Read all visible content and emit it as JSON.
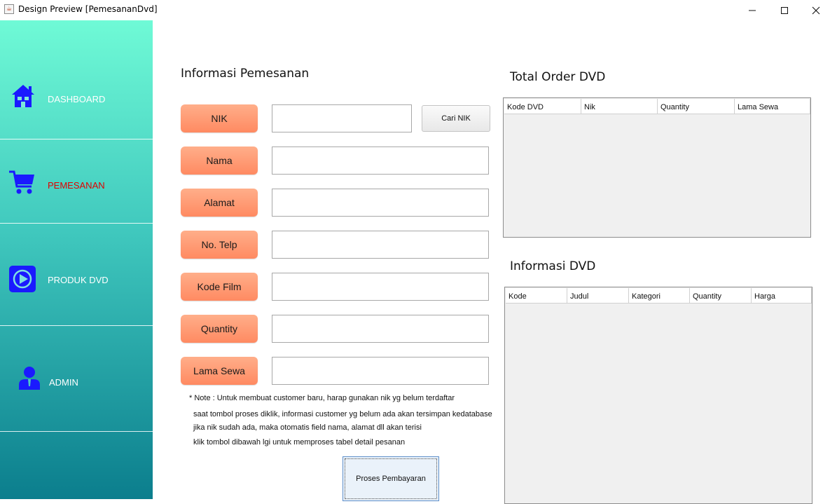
{
  "window": {
    "title": "Design Preview [PemesananDvd]",
    "app_icon_glyph": "☕",
    "controls": [
      "minimize",
      "maximize",
      "close"
    ]
  },
  "sidebar": {
    "gradient": [
      "#6ffad6",
      "#0b7e8d"
    ],
    "items": [
      {
        "label": "DASHBOARD",
        "icon": "home-icon",
        "active": false
      },
      {
        "label": "PEMESANAN",
        "icon": "cart-icon",
        "active": true
      },
      {
        "label": "PRODUK DVD",
        "icon": "play-icon",
        "active": false
      },
      {
        "label": "ADMIN",
        "icon": "user-icon",
        "active": false
      }
    ],
    "active_color": "#e00000",
    "icon_color": "#1a1aff"
  },
  "form": {
    "title": "Informasi Pemesanan",
    "fields": [
      {
        "label": "NIK",
        "value": ""
      },
      {
        "label": "Nama",
        "value": ""
      },
      {
        "label": "Alamat",
        "value": ""
      },
      {
        "label": "No. Telp",
        "value": ""
      },
      {
        "label": "Kode Film",
        "value": ""
      },
      {
        "label": "Quantity",
        "value": ""
      },
      {
        "label": "Lama Sewa",
        "value": ""
      }
    ],
    "cari_button": "Cari NIK",
    "label_color": "#ff9a74",
    "notes": [
      "* Note : Untuk membuat customer baru, harap gunakan nik yg belum terdaftar",
      "saat tombol proses diklik, informasi customer yg belum ada akan tersimpan kedatabase",
      "jika nik sudah ada, maka otomatis field nama, alamat dll akan terisi",
      "klik tombol dibawah lgi untuk memproses tabel detail pesanan"
    ],
    "submit_button": "Proses Pembayaran"
  },
  "order_table": {
    "title": "Total Order DVD",
    "columns": [
      "Kode DVD",
      "Nik",
      "Quantity",
      "Lama Sewa"
    ],
    "rows": []
  },
  "dvd_table": {
    "title": "Informasi DVD",
    "columns": [
      "Kode",
      "Judul",
      "Kategori",
      "Quantity",
      "Harga"
    ],
    "rows": []
  }
}
